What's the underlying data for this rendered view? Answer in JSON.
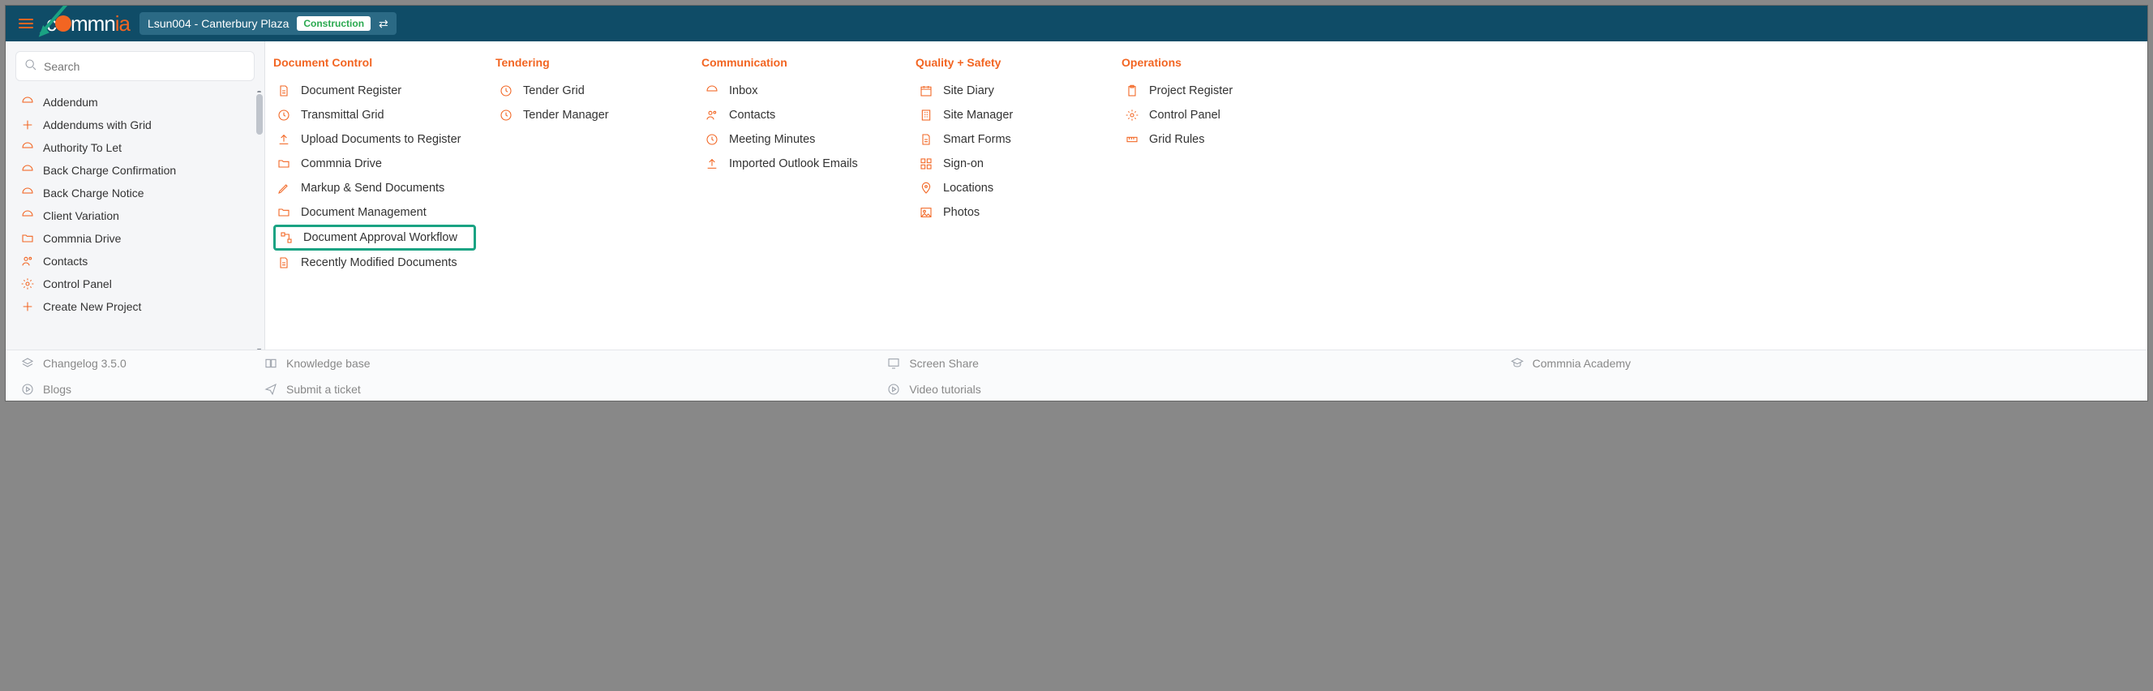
{
  "header": {
    "project_label": "Lsun004 - Canterbury Plaza",
    "badge": "Construction"
  },
  "search": {
    "placeholder": "Search"
  },
  "left_items": [
    {
      "icon": "inbox",
      "label": "Addendum"
    },
    {
      "icon": "plus",
      "label": "Addendums with Grid"
    },
    {
      "icon": "inbox",
      "label": "Authority To Let"
    },
    {
      "icon": "inbox",
      "label": "Back Charge Confirmation"
    },
    {
      "icon": "inbox",
      "label": "Back Charge Notice"
    },
    {
      "icon": "inbox",
      "label": "Client Variation"
    },
    {
      "icon": "folder",
      "label": "Commnia Drive"
    },
    {
      "icon": "people",
      "label": "Contacts"
    },
    {
      "icon": "gear",
      "label": "Control Panel"
    },
    {
      "icon": "plus",
      "label": "Create New Project"
    }
  ],
  "columns": {
    "doc": {
      "title": "Document Control",
      "items": [
        {
          "icon": "doc",
          "label": "Document Register"
        },
        {
          "icon": "clock",
          "label": "Transmittal Grid"
        },
        {
          "icon": "upload",
          "label": "Upload Documents to Register"
        },
        {
          "icon": "folder",
          "label": "Commnia Drive"
        },
        {
          "icon": "pen",
          "label": "Markup & Send Documents"
        },
        {
          "icon": "folder",
          "label": "Document Management"
        },
        {
          "icon": "workflow",
          "label": "Document Approval Workflow",
          "highlight": true
        },
        {
          "icon": "doc",
          "label": "Recently Modified Documents"
        }
      ]
    },
    "ten": {
      "title": "Tendering",
      "items": [
        {
          "icon": "clock",
          "label": "Tender Grid"
        },
        {
          "icon": "clock",
          "label": "Tender Manager"
        }
      ]
    },
    "com": {
      "title": "Communication",
      "items": [
        {
          "icon": "inbox",
          "label": "Inbox"
        },
        {
          "icon": "people",
          "label": "Contacts"
        },
        {
          "icon": "clock",
          "label": "Meeting Minutes"
        },
        {
          "icon": "upload",
          "label": "Imported Outlook Emails"
        }
      ]
    },
    "qs": {
      "title": "Quality + Safety",
      "items": [
        {
          "icon": "calendar",
          "label": "Site Diary"
        },
        {
          "icon": "building",
          "label": "Site Manager"
        },
        {
          "icon": "doc",
          "label": "Smart Forms"
        },
        {
          "icon": "grid",
          "label": "Sign-on"
        },
        {
          "icon": "pin",
          "label": "Locations"
        },
        {
          "icon": "image",
          "label": "Photos"
        }
      ]
    },
    "ops": {
      "title": "Operations",
      "items": [
        {
          "icon": "clipboard",
          "label": "Project Register"
        },
        {
          "icon": "gear",
          "label": "Control Panel"
        },
        {
          "icon": "ruler",
          "label": "Grid Rules"
        }
      ]
    }
  },
  "footer": [
    {
      "icon": "layers",
      "label": "Changelog 3.5.0"
    },
    {
      "icon": "book",
      "label": "Knowledge base"
    },
    {
      "icon": "screen",
      "label": "Screen Share"
    },
    {
      "icon": "cap",
      "label": "Commnia Academy"
    },
    {
      "icon": "play",
      "label": "Blogs"
    },
    {
      "icon": "send",
      "label": "Submit a ticket"
    },
    {
      "icon": "play",
      "label": "Video tutorials"
    }
  ]
}
